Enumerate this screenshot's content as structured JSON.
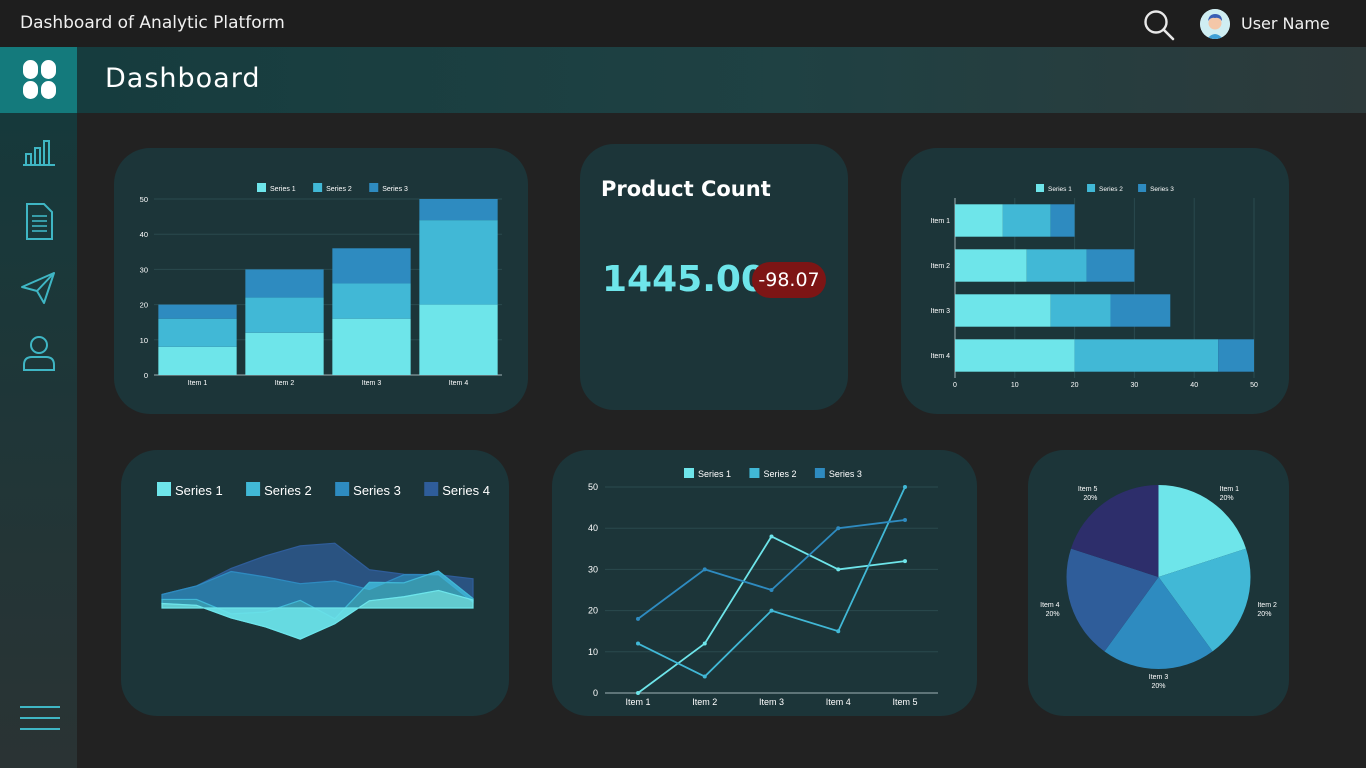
{
  "topbar": {
    "title": "Dashboard of Analytic Platform",
    "user_name": "User Name"
  },
  "header": {
    "title": "Dashboard"
  },
  "sidebar": {
    "items": [
      {
        "icon": "bar-chart-icon"
      },
      {
        "icon": "document-icon"
      },
      {
        "icon": "send-icon"
      },
      {
        "icon": "user-icon"
      }
    ],
    "menu_icon": "menu-icon"
  },
  "product_count": {
    "title": "Product Count",
    "value": "1445.00",
    "change": "-98.07",
    "badge_color": "#7d1515"
  },
  "colors": {
    "series1": "#6ee5ea",
    "series2": "#41b8d6",
    "series3": "#2e8bc0",
    "series4": "#2f5d9a",
    "series5": "#2d2e6b",
    "card": "#1c3539",
    "accent": "#147a7c"
  },
  "chart_data": [
    {
      "type": "bar",
      "stacked": true,
      "orientation": "vertical",
      "categories": [
        "Item 1",
        "Item 2",
        "Item 3",
        "Item 4"
      ],
      "series": [
        {
          "name": "Series 1",
          "values": [
            8,
            12,
            16,
            20
          ]
        },
        {
          "name": "Series 2",
          "values": [
            8,
            10,
            10,
            24
          ]
        },
        {
          "name": "Series 3",
          "values": [
            4,
            8,
            10,
            6
          ]
        }
      ],
      "yticks": [
        "0",
        "10",
        "20",
        "30",
        "40",
        "50"
      ],
      "ylim": [
        0,
        50
      ],
      "legend": "top"
    },
    {
      "type": "bar",
      "stacked": true,
      "orientation": "horizontal",
      "categories": [
        "Item 1",
        "Item 2",
        "Item 3",
        "Item 4"
      ],
      "series": [
        {
          "name": "Series 1",
          "values": [
            8,
            12,
            16,
            20
          ]
        },
        {
          "name": "Series 2",
          "values": [
            8,
            10,
            10,
            24
          ]
        },
        {
          "name": "Series 3",
          "values": [
            4,
            8,
            10,
            6
          ]
        }
      ],
      "xticks": [
        "0",
        "10",
        "20",
        "30",
        "40",
        "50"
      ],
      "xlim": [
        0,
        50
      ],
      "legend": "top"
    },
    {
      "type": "area",
      "stacked": true,
      "series": [
        {
          "name": "Series 1",
          "values": [
            1,
            0.6,
            -2.2,
            -4.2,
            -6.9,
            -3.5,
            1.6,
            2.5,
            3.9,
            1.8
          ]
        },
        {
          "name": "Series 2",
          "values": [
            0.9,
            1.3,
            0.9,
            3.3,
            8.6,
            1.1,
            4.1,
            3.1,
            4.3,
            0.3
          ]
        },
        {
          "name": "Series 3",
          "values": [
            1.1,
            3,
            9.4,
            7.8,
            3.7,
            8.4,
            -1.6,
            1.8,
            -0.8,
            -0.8
          ]
        },
        {
          "name": "Series 4",
          "values": [
            0,
            0,
            0.7,
            4.7,
            8.4,
            8.4,
            4.4,
            0.1,
            0,
            5.2
          ]
        }
      ],
      "legend": "top"
    },
    {
      "type": "line",
      "categories": [
        "Item 1",
        "Item 2",
        "Item 3",
        "Item 4",
        "Item 5"
      ],
      "series": [
        {
          "name": "Series 1",
          "values": [
            0,
            12,
            38,
            30,
            32
          ]
        },
        {
          "name": "Series 2",
          "values": [
            12,
            4,
            20,
            15,
            50
          ]
        },
        {
          "name": "Series 3",
          "values": [
            18,
            30,
            25,
            40,
            42
          ]
        }
      ],
      "yticks": [
        "0",
        "10",
        "20",
        "30",
        "40",
        "50"
      ],
      "ylim": [
        0,
        50
      ],
      "legend": "top"
    },
    {
      "type": "pie",
      "slices": [
        {
          "label": "Item 1",
          "pct": "20%",
          "value": 20
        },
        {
          "label": "Item 2",
          "pct": "20%",
          "value": 20
        },
        {
          "label": "Item 3",
          "pct": "20%",
          "value": 20
        },
        {
          "label": "Item 4",
          "pct": "20%",
          "value": 20
        },
        {
          "label": "Item 5",
          "pct": "20%",
          "value": 20
        }
      ]
    }
  ]
}
